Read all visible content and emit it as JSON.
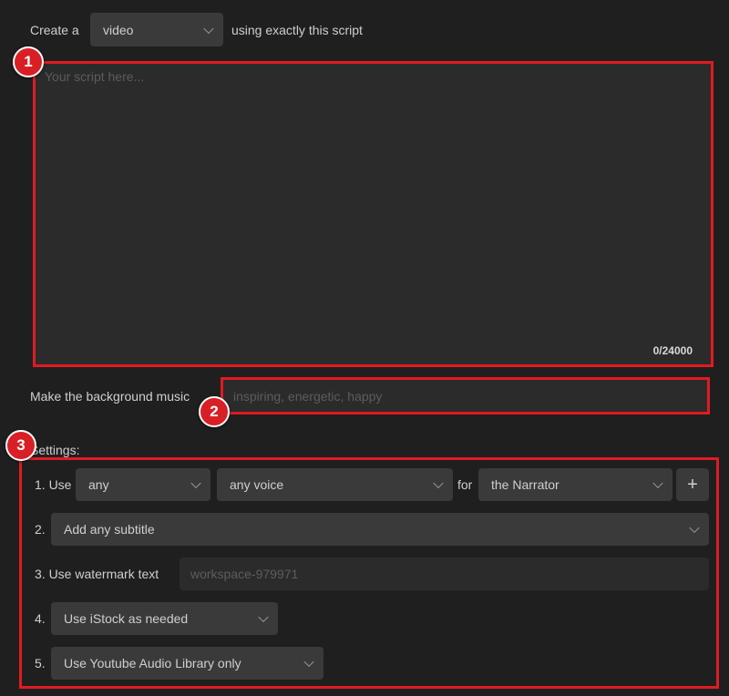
{
  "header": {
    "prefix": "Create a",
    "media_type": "video",
    "suffix": "using exactly this script"
  },
  "script": {
    "placeholder": "Your script here...",
    "counter": "0/24000"
  },
  "music": {
    "label": "Make the background music",
    "placeholder": "inspiring, energetic, happy"
  },
  "settings": {
    "title": "Settings:",
    "row1": {
      "num": "1. Use",
      "voice_type": "any",
      "voice": "any voice",
      "for_label": "for",
      "role": "the Narrator",
      "add_label": "+"
    },
    "row2": {
      "num": "2.",
      "subtitle": "Add any subtitle"
    },
    "row3": {
      "label": "3. Use watermark text",
      "placeholder": "workspace-979971"
    },
    "row4": {
      "num": "4.",
      "stock": "Use iStock as needed"
    },
    "row5": {
      "num": "5.",
      "audio": "Use Youtube Audio Library only"
    }
  },
  "annotations": {
    "b1": "1",
    "b2": "2",
    "b3": "3"
  },
  "colors": {
    "background": "#1f1f1f",
    "highlight": "#e01b22",
    "field": "#3a3a3a"
  }
}
